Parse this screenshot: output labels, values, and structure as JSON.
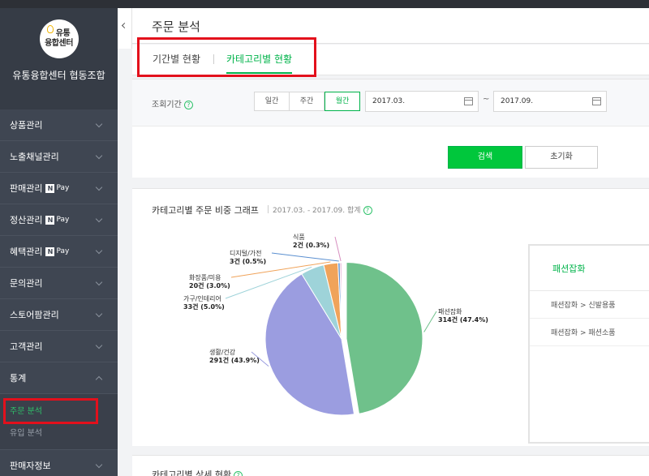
{
  "brand": {
    "logo_line1": "유통",
    "logo_line2": "융합센터",
    "name": "유통융합센터 협동조합"
  },
  "sidebar": {
    "items": [
      {
        "label": "상품관리",
        "npay": false
      },
      {
        "label": "노출채널관리",
        "npay": false
      },
      {
        "label": "판매관리",
        "npay": true
      },
      {
        "label": "정산관리",
        "npay": true
      },
      {
        "label": "혜택관리",
        "npay": true
      },
      {
        "label": "문의관리",
        "npay": false
      },
      {
        "label": "스토어팜관리",
        "npay": false
      },
      {
        "label": "고객관리",
        "npay": false
      },
      {
        "label": "통계",
        "npay": false,
        "expanded": true
      }
    ],
    "npay_n": "N",
    "npay_text": "Pay",
    "stats_sub": [
      {
        "label": "주문 분석",
        "active": true
      },
      {
        "label": "유입 분석",
        "active": false
      }
    ],
    "last_item": "판매자정보"
  },
  "page": {
    "title": "주문 분석"
  },
  "tabs": [
    {
      "label": "기간별 현황",
      "active": false
    },
    {
      "label": "카테고리별 현황",
      "active": true
    }
  ],
  "search": {
    "period_label": "조회기간",
    "help_glyph": "?",
    "periods": [
      {
        "label": "일간",
        "active": false
      },
      {
        "label": "주간",
        "active": false
      },
      {
        "label": "월간",
        "active": true
      }
    ],
    "start_date": "2017.03.",
    "end_date": "2017.09.",
    "tilde": "~",
    "search_button": "검색",
    "reset_button": "초기화"
  },
  "chart_panel": {
    "title": "카테고리별 주문 비중 그래프",
    "subtitle": "2017.03. - 2017.09. 합계",
    "side_head": "패션잡화",
    "side_rows": [
      "패션잡화 > 신발용품",
      "패션잡화 > 패션소품"
    ]
  },
  "chart_data": {
    "type": "pie",
    "unit": "건",
    "slices": [
      {
        "label": "패션잡화",
        "count": 314,
        "percent": 47.4,
        "display": "314건 (47.4%)",
        "color": "#6fc18b"
      },
      {
        "label": "생활/건강",
        "count": 291,
        "percent": 43.9,
        "display": "291건 (43.9%)",
        "color": "#9b9de0"
      },
      {
        "label": "가구/인테리어",
        "count": 33,
        "percent": 5.0,
        "display": "33건 (5.0%)",
        "color": "#9ed3d9"
      },
      {
        "label": "화장품/미용",
        "count": 20,
        "percent": 3.0,
        "display": "20건 (3.0%)",
        "color": "#f0a35a"
      },
      {
        "label": "디지털/가전",
        "count": 3,
        "percent": 0.5,
        "display": "3건 (0.5%)",
        "color": "#5a8fd0"
      },
      {
        "label": "식품",
        "count": 2,
        "percent": 0.3,
        "display": "2건 (0.3%)",
        "color": "#d78fc0"
      }
    ]
  },
  "detail_panel": {
    "title": "카테고리별 상세 현황"
  }
}
